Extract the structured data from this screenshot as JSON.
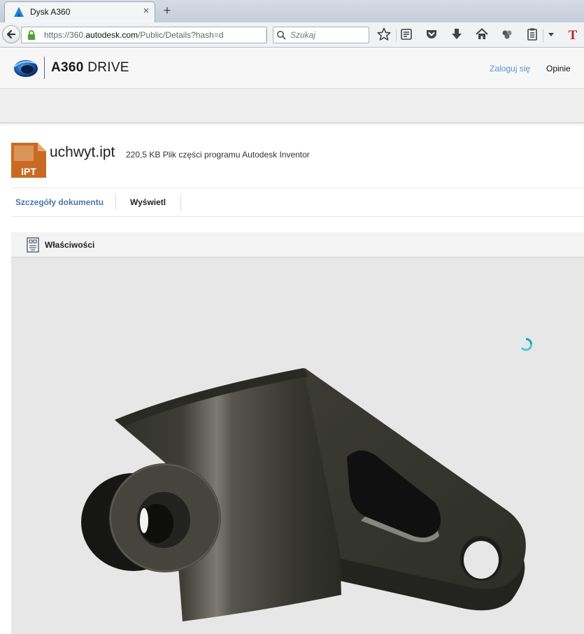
{
  "browser": {
    "tab_title": "Dysk A360",
    "tab_close": "×",
    "new_tab": "+",
    "url_prefix": "https://360.",
    "url_domain": "autodesk.com",
    "url_rest": "/Public/Details?hash=d",
    "search_placeholder": "Szukaj",
    "toolbar_icons": [
      "star-icon",
      "reading-list-icon",
      "pocket-icon",
      "download-icon",
      "home-icon",
      "extension-icon",
      "clipboard-icon",
      "menu-dropdown-icon",
      "t-extension-icon"
    ]
  },
  "header": {
    "logo_text_a": "A360",
    "logo_text_b": " DRIVE",
    "login_label": "Zaloguj się",
    "feedback_label": "Opinie"
  },
  "file": {
    "icon_label": "IPT",
    "name": "uchwyt.ipt",
    "meta": "220,5 KB Plik części programu Autodesk Inventor"
  },
  "tabs": {
    "details": "Szczegóły dokumentu",
    "view": "Wyświetl"
  },
  "viewer": {
    "properties_label": "Właściwości"
  },
  "colors": {
    "link": "#5b8ed1",
    "tab_active": "#4a78a8",
    "file_icon": "#c96a24",
    "model": "#3d3d37",
    "viewport_bg": "#e7e7e7"
  }
}
